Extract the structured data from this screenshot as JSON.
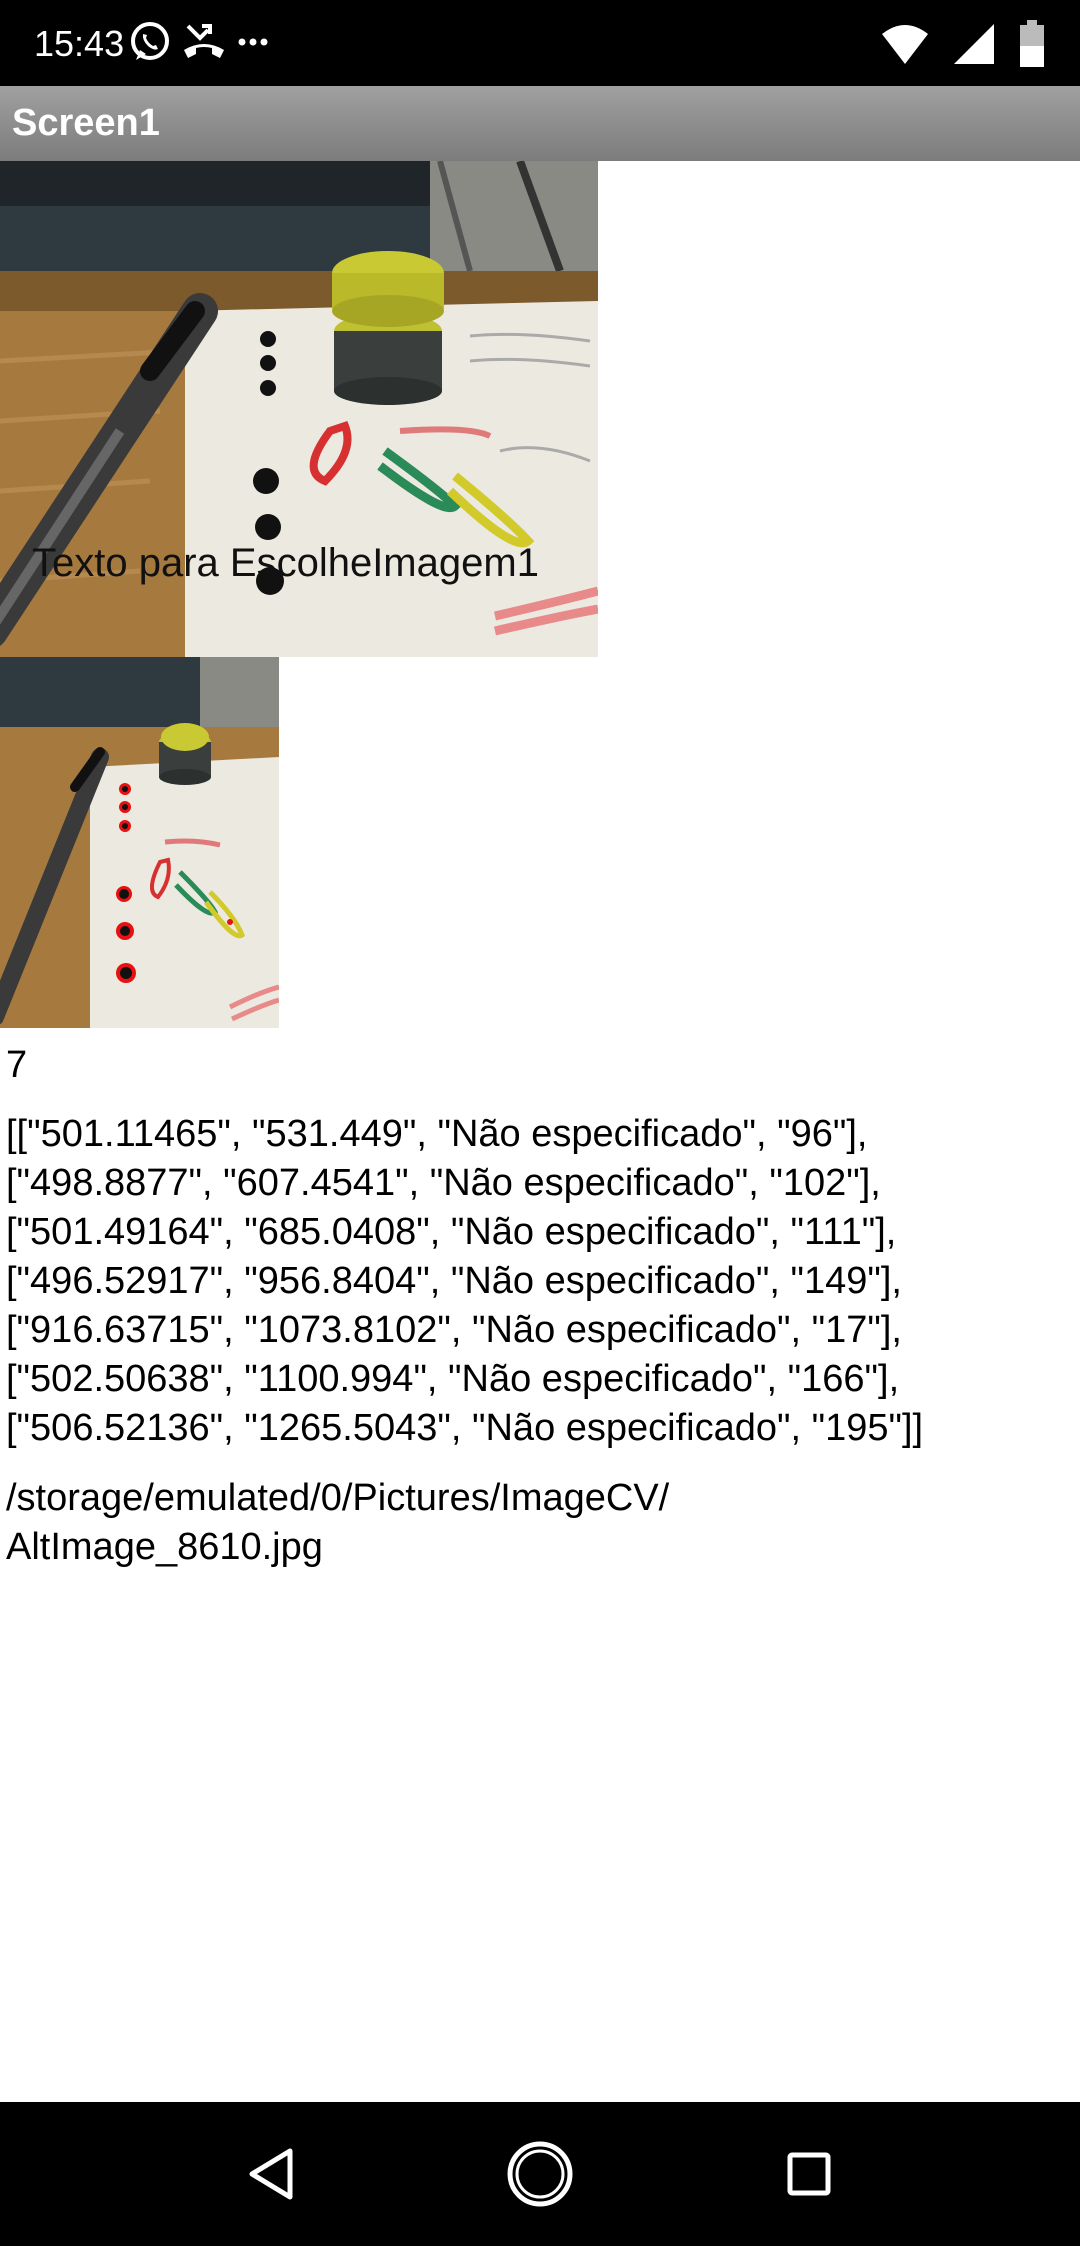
{
  "status_bar": {
    "time": "15:43",
    "notification_icons": [
      "whatsapp-icon",
      "missed-call-icon",
      "more-notifications-icon"
    ],
    "system_icons": [
      "wifi-icon",
      "signal-icon",
      "battery-icon"
    ]
  },
  "app_bar": {
    "title": "Screen1"
  },
  "image_picker": {
    "text": "Texto para EscolheImagem1"
  },
  "count_label": "7",
  "results_label": {
    "lines": [
      "[[\"501.11465\", \"531.449\", \"Não especificado\", \"96\"],",
      "[\"498.8877\", \"607.4541\", \"Não especificado\", \"102\"],",
      "[\"501.49164\", \"685.0408\", \"Não especificado\", \"111\"],",
      "[\"496.52917\", \"956.8404\", \"Não especificado\", \"149\"],",
      "[\"916.63715\", \"1073.8102\", \"Não especificado\", \"17\"],",
      "[\"502.50638\", \"1100.994\", \"Não especificado\", \"166\"],",
      "[\"506.52136\", \"1265.5043\", \"Não especificado\", \"195\"]]"
    ]
  },
  "path_label": {
    "lines": [
      "/storage/emulated/0/Pictures/ImageCV/",
      "AltImage_8610.jpg"
    ]
  },
  "nav_bar": {
    "buttons": [
      "back-icon",
      "home-icon",
      "recents-icon"
    ]
  },
  "colors": {
    "status_bar_bg": "#000000",
    "title_bar_bg": "#8a8a8a",
    "title_text": "#ffffff",
    "detection_marker": "#e81010"
  }
}
